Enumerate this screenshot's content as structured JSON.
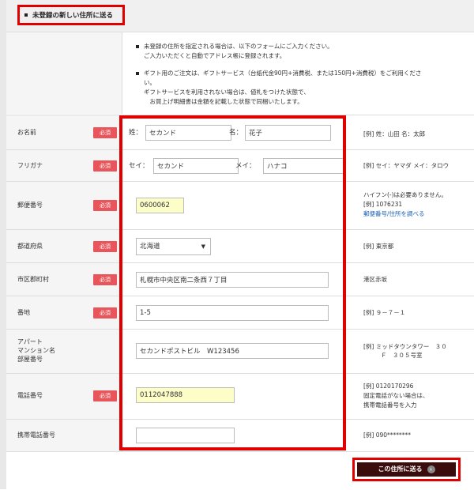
{
  "header": {
    "title": "未登録の新しい住所に送る"
  },
  "notes": [
    {
      "lines": [
        "未登録の住所を指定される場合は、以下のフォームにご入力ください。",
        "ご入力いただくと自動でアドレス帳に登録されます。"
      ]
    },
    {
      "lines": [
        "ギフト用のご注文は、ギフトサービス（台紙代金90円+消費税、または150円+消費税）をご利用くださ",
        "い。",
        "ギフトサービスを利用されない場合は、値札をつけた状態で、",
        "　お買上げ明細書は金額を記載した状態で同梱いたします。"
      ]
    }
  ],
  "required_label": "必須",
  "fields": {
    "name": {
      "label": "お名前",
      "sei_prefix": "姓：",
      "sei_value": "セカンド",
      "mei_prefix": "名：",
      "mei_value": "花子",
      "example": "[例] 姓：山田 名：太郎"
    },
    "kana": {
      "label": "フリガナ",
      "sei_prefix": "セイ：",
      "sei_value": "セカンド",
      "mei_prefix": "メイ：",
      "mei_value": "ハナコ",
      "example": "[例] セイ：ヤマダ メイ：タロウ"
    },
    "postal": {
      "label": "郵便番号",
      "value": "0600062",
      "example1": "ハイフン(-)は必要ありません。",
      "example2": "[例] 1076231",
      "link": "郵便番号/住所を調べる"
    },
    "prefecture": {
      "label": "都道府県",
      "value": "北海道",
      "example": "[例] 東京都"
    },
    "city": {
      "label": "市区郡町村",
      "value": "札幌市中央区南二条西７丁目",
      "example": "港区赤坂"
    },
    "street": {
      "label": "番地",
      "value": "1-5",
      "example": "[例] ９－７－１"
    },
    "building": {
      "label1": "アパート",
      "label2": "マンション名",
      "label3": "部屋番号",
      "value": "セカンドポストビル　W123456",
      "example1": "[例] ミッドタウンタワー　３０",
      "example2": "Ｆ　３０５号室"
    },
    "phone": {
      "label": "電話番号",
      "value": "0112047888",
      "example1": "[例] 0120170296",
      "example2": "固定電話がない場合は、",
      "example3": "携帯電話番号を入力"
    },
    "mobile": {
      "label": "携帯電話番号",
      "value": "",
      "example": "[例] 090********"
    }
  },
  "submit": {
    "label": "この住所に送る"
  },
  "colors": {
    "highlight": "#e00000",
    "required_badge": "#e8555b",
    "submit_bg": "#3a0c0c",
    "input_highlight": "#fdfdc8"
  }
}
